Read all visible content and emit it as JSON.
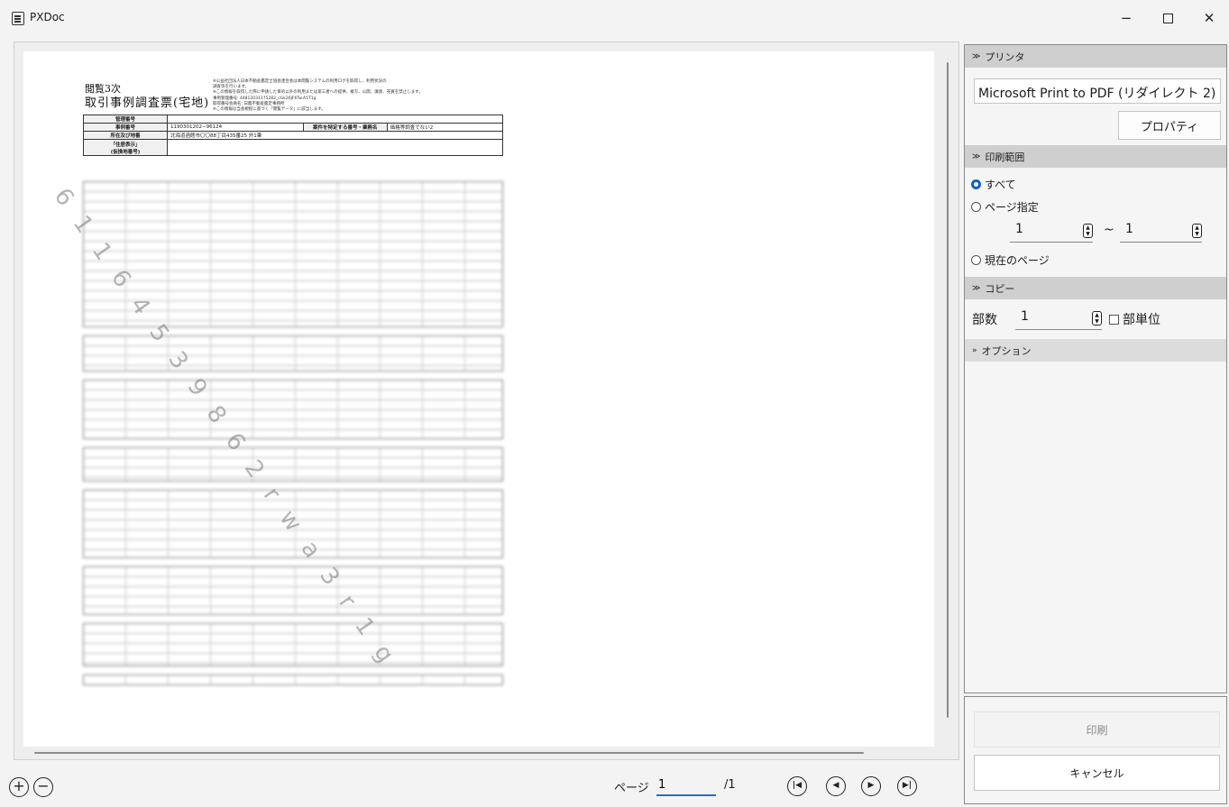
{
  "window": {
    "title": "PXDoc",
    "minimize": "−",
    "close": "✕"
  },
  "document": {
    "head_line1": "閲覧3次",
    "head_line2": "取引事例調査票(宅地)",
    "notes": [
      "※公益社団法人日本不動産鑑定士協会連合会は本閲覧システムの利用ログを取得し、利用状況の",
      "調査等を行います。",
      "※この情報を取得した際に申請した目的以外の利用または第三者への提供、複写、公開、譲渡、売買を禁止します。",
      "事例管理番号: 44812031175282_cGk26JF6Tw.A5T1g",
      "取得番号会員名: 日鑑不動産鑑定事務所",
      "※この情報は当会規程に基づく「閲覧データ」に該当します。"
    ],
    "table": {
      "row1_label": "管理番号",
      "row2_label": "事例番号",
      "row2_value": "1190301202−96124",
      "row2_label2": "案件を特定する番号・業務名",
      "row2_value2": "価格等調査でない2",
      "row3_label": "所在及び地番",
      "row3_value": "北海道函館市〇〇88丁目435番25 外1筆",
      "row4_label_a": "「住居表示」",
      "row4_label_b": "(仮換地番号)"
    },
    "watermark": "6 1 1 6 4 5 3 9 8 6 2 r w a 3 r 1 g"
  },
  "bottom_bar": {
    "zoom_in": "+",
    "zoom_out": "−",
    "page_label": "ページ",
    "page_value": "1",
    "page_total": "/1",
    "first": "|◀",
    "prev": "◀",
    "next": "▶",
    "last": "▶|"
  },
  "side": {
    "printer_header": "プリンタ",
    "printer_value": "Microsoft Print to PDF (リダイレクト 2)",
    "properties_button": "プロパティ",
    "range_header": "印刷範囲",
    "range_all": "すべて",
    "range_pages": "ページ指定",
    "range_from": "1",
    "range_tilde": "~",
    "range_to": "1",
    "range_current": "現在のページ",
    "copy_header": "コピー",
    "copies_label": "部数",
    "copies_value": "1",
    "collate_label": "部単位",
    "options_header": "オプション"
  },
  "actions": {
    "print": "印刷",
    "cancel": "キャンセル"
  }
}
